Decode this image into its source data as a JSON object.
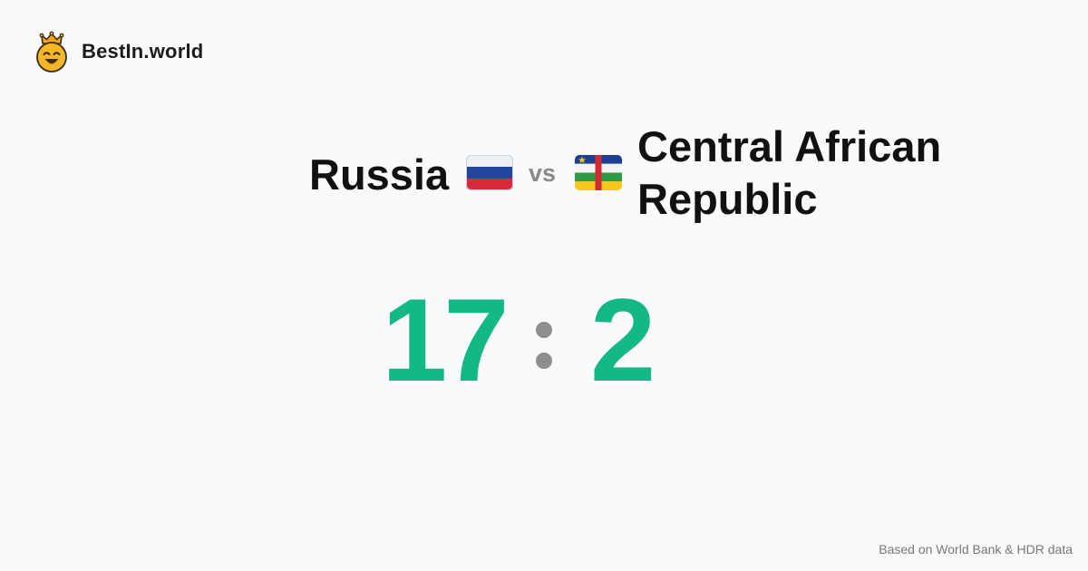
{
  "brand": {
    "name": "BestIn.world",
    "logo_icon": "crowned-smiley-icon"
  },
  "matchup": {
    "left_team": {
      "name": "Russia",
      "flag_icon": "russia-flag-icon"
    },
    "vs_label": "vs",
    "right_team": {
      "name_line1": "Central African",
      "name_line2": "Republic",
      "flag_icon": "central-african-republic-flag-icon"
    }
  },
  "score": {
    "left": "17",
    "separator": ":",
    "right": "2",
    "color": "#14b886"
  },
  "footer": {
    "source": "Based on World Bank & HDR data"
  }
}
